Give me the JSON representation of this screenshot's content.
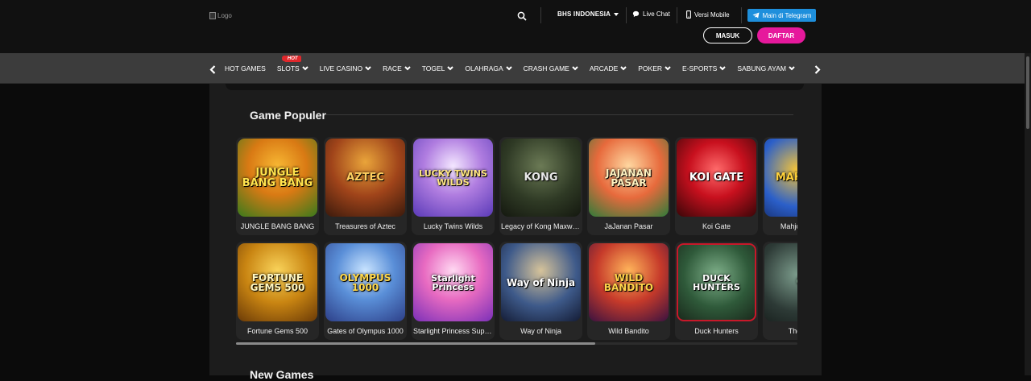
{
  "header": {
    "logo_alt": "Logo",
    "lang_label": "BHS INDONESIA",
    "live_chat_label": "Live Chat",
    "mobile_label": "Versi Mobile",
    "telegram_label": "Main di Telegram",
    "login_label": "MASUK",
    "register_label": "DAFTAR",
    "telegram_color": "#1e8fdc",
    "register_color": "#e6199c"
  },
  "nav": {
    "hot_badge": "HOT",
    "items": [
      {
        "label": "HOT GAMES"
      },
      {
        "label": "SLOTS"
      },
      {
        "label": "LIVE CASINO"
      },
      {
        "label": "RACE"
      },
      {
        "label": "TOGEL"
      },
      {
        "label": "OLAHRAGA"
      },
      {
        "label": "CRASH GAME"
      },
      {
        "label": "ARCADE"
      },
      {
        "label": "POKER"
      },
      {
        "label": "E-SPORTS"
      },
      {
        "label": "SABUNG AYAM"
      }
    ]
  },
  "main": {
    "popular_title": "Game Populer",
    "next_title": "New Games",
    "games": [
      {
        "name": "JUNGLE BANG BANG",
        "thumb_text": "JUNGLE BANG BANG"
      },
      {
        "name": "Treasures of Aztec",
        "thumb_text": "AZTEC"
      },
      {
        "name": "Lucky Twins Wilds",
        "thumb_text": "LUCKY TWINS WILDS"
      },
      {
        "name": "Legacy of Kong Maxways",
        "thumb_text": "KONG"
      },
      {
        "name": "JaJanan Pasar",
        "thumb_text": "JAJANAN PASAR"
      },
      {
        "name": "Koi Gate",
        "thumb_text": "KOI GATE"
      },
      {
        "name": "Mahjong Ways",
        "thumb_text": "MAHJONG"
      },
      {
        "name": "Fortune Gems 500",
        "thumb_text": "FORTUNE GEMS 500"
      },
      {
        "name": "Gates of Olympus 1000",
        "thumb_text": "OLYMPUS 1000"
      },
      {
        "name": "Starlight Princess Super Scatter",
        "thumb_text": "Starlight Princess"
      },
      {
        "name": "Way of Ninja",
        "thumb_text": "Way of Ninja"
      },
      {
        "name": "Wild Bandito",
        "thumb_text": "WILD BANDITO"
      },
      {
        "name": "Duck Hunters",
        "thumb_text": "DUCK HUNTERS"
      },
      {
        "name": "The Crypt",
        "thumb_text": "CR"
      }
    ],
    "games_scroll_fraction": 0.64
  }
}
